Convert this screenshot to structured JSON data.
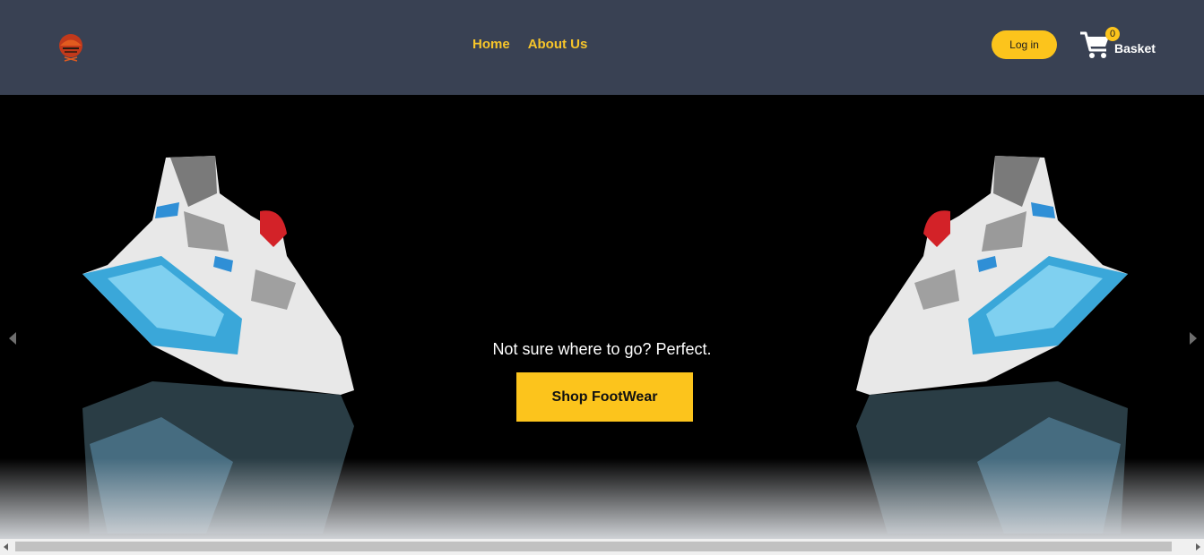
{
  "header": {
    "logo_icon": "brand-logo-icon",
    "nav_links": [
      {
        "label": "Home"
      },
      {
        "label": "About Us"
      }
    ],
    "login_label": "Log in",
    "basket": {
      "icon": "shopping-cart-icon",
      "count": "0",
      "label": "Basket"
    }
  },
  "hero": {
    "tagline": "Not sure where to go? Perfect.",
    "cta_label": "Shop FootWear",
    "prev_icon": "chevron-left-icon",
    "next_icon": "chevron-right-icon"
  },
  "colors": {
    "navbar_bg": "#394153",
    "accent": "#fcc41c",
    "nav_link": "#f7c52a",
    "hero_bg": "#000000"
  }
}
